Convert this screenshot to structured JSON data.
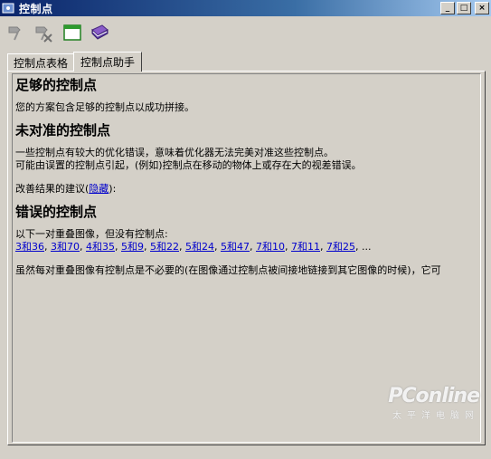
{
  "window": {
    "title": "控制点",
    "buttons": [
      "_",
      "□",
      "×"
    ]
  },
  "toolbar": {
    "icons": [
      "pin-icon",
      "pin-remove-icon",
      "window-icon",
      "book-icon"
    ]
  },
  "tabs": [
    {
      "label": "控制点表格",
      "active": false
    },
    {
      "label": "控制点助手",
      "active": true
    }
  ],
  "sections": {
    "good": {
      "heading": "足够的控制点",
      "text": "您的方案包含足够的控制点以成功拼接。"
    },
    "misaligned": {
      "heading": "未对准的控制点",
      "line1": "一些控制点有较大的优化错误，意味着优化器无法完美对准这些控制点。",
      "line2": "可能由误置的控制点引起，(例如)控制点在移动的物体上或存在大的视差错误。",
      "suggest_prefix": "改善结果的建议(",
      "hide_link": "隐藏",
      "suggest_suffix": "):"
    },
    "errors": {
      "heading": "错误的控制点",
      "intro": "以下一对重叠图像，但没有控制点:",
      "pairs": [
        "3和36",
        "3和70",
        "4和35",
        "5和9",
        "5和22",
        "5和24",
        "5和47",
        "7和10",
        "7和11",
        "7和25"
      ],
      "ellipsis": "...",
      "note": "虽然每对重叠图像有控制点是不必要的(在图像通过控制点被间接地链接到其它图像的时候)，它可"
    }
  },
  "watermark": {
    "brand": "PConline",
    "sub": "太平洋电脑网"
  }
}
